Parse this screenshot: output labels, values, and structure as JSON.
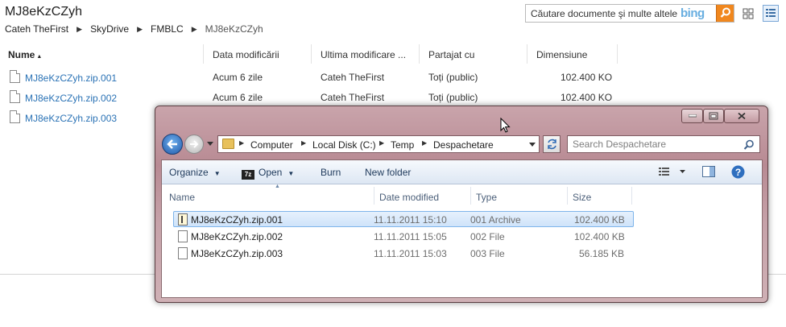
{
  "skydrive": {
    "title": "MJ8eKzCZyh",
    "breadcrumb": [
      "Cateh TheFirst",
      "SkyDrive",
      "FMBLC",
      "MJ8eKzCZyh"
    ],
    "search_placeholder": "Căutare documente şi multe altele",
    "search_brand": "bing",
    "columns": {
      "name": "Nume",
      "date": "Data modificării",
      "last_modified_by": "Ultima modificare ...",
      "shared": "Partajat cu",
      "size": "Dimensiune"
    },
    "files": [
      {
        "name": "MJ8eKzCZyh.zip.001",
        "date": "Acum 6 zile",
        "by": "Cateh TheFirst",
        "shared": "Toți (public)",
        "size": "102.400 KO"
      },
      {
        "name": "MJ8eKzCZyh.zip.002",
        "date": "Acum 6 zile",
        "by": "Cateh TheFirst",
        "shared": "Toți (public)",
        "size": "102.400 KO"
      },
      {
        "name": "MJ8eKzCZyh.zip.003"
      }
    ]
  },
  "explorer": {
    "address": [
      "Computer",
      "Local Disk (C:)",
      "Temp",
      "Despachetare"
    ],
    "search_placeholder": "Search Despachetare",
    "toolbar": {
      "organize": "Organize",
      "open": "Open",
      "burn": "Burn",
      "new_folder": "New folder"
    },
    "columns": {
      "name": "Name",
      "date": "Date modified",
      "type": "Type",
      "size": "Size"
    },
    "files": [
      {
        "name": "MJ8eKzCZyh.zip.001",
        "date": "11.11.2011 15:10",
        "type": "001 Archive",
        "size": "102.400 KB",
        "selected": true
      },
      {
        "name": "MJ8eKzCZyh.zip.002",
        "date": "11.11.2011 15:05",
        "type": "002 File",
        "size": "102.400 KB"
      },
      {
        "name": "MJ8eKzCZyh.zip.003",
        "date": "11.11.2011 15:03",
        "type": "003 File",
        "size": "56.185 KB"
      }
    ]
  },
  "colors": {
    "link": "#2a72b5",
    "bing_orange": "#f0871e",
    "window_frame": "#c29aa1",
    "selection": "#cfe3fa"
  }
}
